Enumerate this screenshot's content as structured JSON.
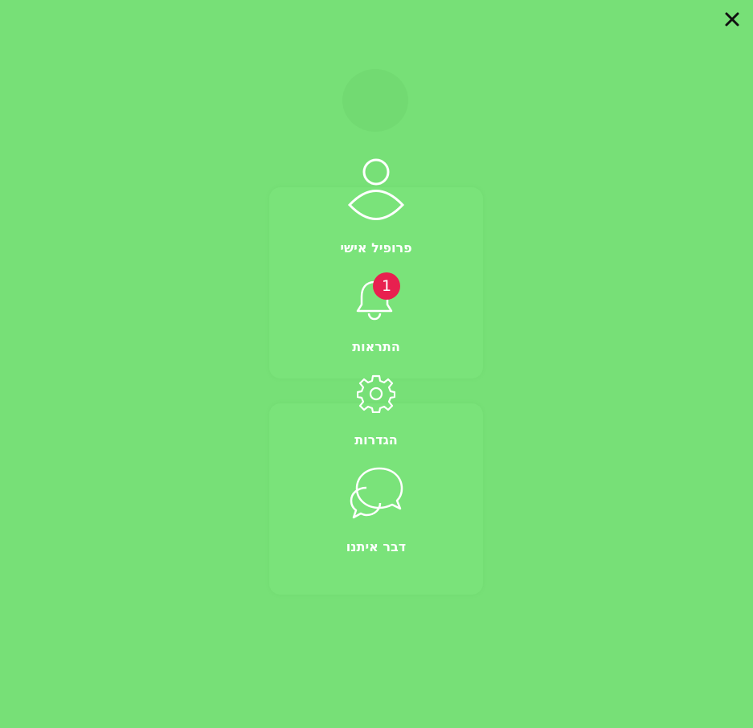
{
  "background_color": "#77e077",
  "close": {
    "icon": "close-icon"
  },
  "menu": {
    "items": [
      {
        "label": "פרופיל אישי",
        "icon": "user-icon"
      },
      {
        "label": "התראות",
        "icon": "bell-icon",
        "badge": "1"
      },
      {
        "label": "הגדרות",
        "icon": "gear-icon"
      },
      {
        "label": "דבר איתנו",
        "icon": "chat-bubbles-icon"
      }
    ]
  },
  "colors": {
    "badge": "#e8204f",
    "icon_stroke": "#ffffff",
    "label_text": "#ffffff"
  }
}
